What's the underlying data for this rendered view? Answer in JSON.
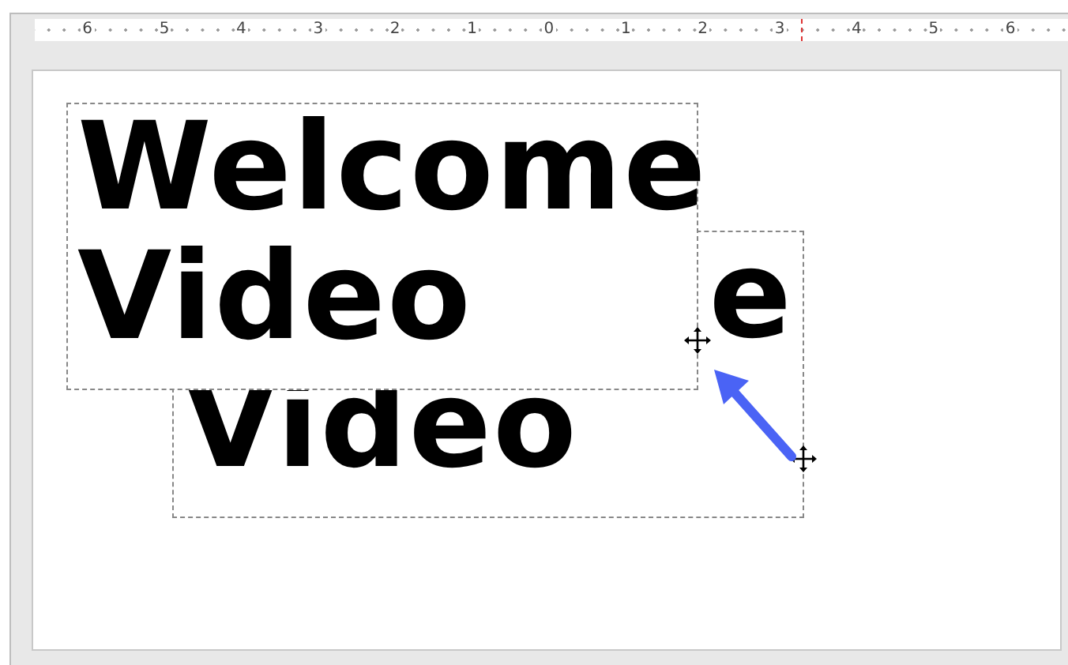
{
  "ruler": {
    "labels": [
      "6",
      "5",
      "4",
      "3",
      "2",
      "1",
      "0",
      "1",
      "2",
      "3",
      "4",
      "5",
      "6"
    ]
  },
  "back_text_box": {
    "fragment": "e",
    "line": "Video"
  },
  "front_text_box": {
    "lines": [
      "Welcome",
      "Video"
    ]
  }
}
